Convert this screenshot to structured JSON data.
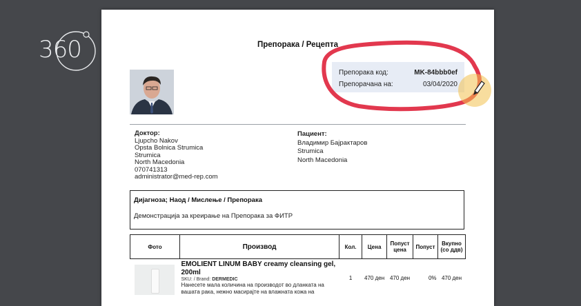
{
  "brand": {
    "logo_text": "360"
  },
  "document": {
    "title": "Препорака / Рецепта",
    "code_label": "Препорака код:",
    "code_value": "MK-84bbb0ef",
    "date_label": "Препорачана на:",
    "date_value": "03/04/2020"
  },
  "doctor": {
    "heading": "Доктор:",
    "lines": [
      "Ljupcho Nakov",
      "Opsta Bolnica Strumica",
      "Strumica",
      "North Macedonia",
      "070741313",
      "administrator@med-rep.com"
    ]
  },
  "patient": {
    "heading": "Пациент:",
    "lines": [
      "Владимир Бајрактаров",
      "Strumica",
      "North Macedonia"
    ]
  },
  "diagnosis": {
    "heading": "Дијагноза; Наод / Мислење / Препорака",
    "text": "Демонстрација за креирање на Препорака за ФИТР"
  },
  "table": {
    "headers": [
      "Фото",
      "Производ",
      "Кол.",
      "Цена",
      "Попуст цена",
      "Попуст",
      "Вкупно (со ддв)"
    ],
    "rows": [
      {
        "product_name": "EMOLIENT LINUM BABY creamy cleansing gel, 200ml",
        "sku_label": "SKU: / Brand:",
        "brand": "DERMEDIC",
        "description": "Нанесете мала количина на производот во дланката на вашата рака, нежно масирајте на влажната кожа на",
        "qty": "1",
        "price": "470 ден",
        "discount_price": "470 ден",
        "discount": "0%",
        "total": "470 ден"
      }
    ]
  },
  "annotation": {
    "highlight_color": "#e0273f",
    "cursor_color": "#f2c14e"
  }
}
